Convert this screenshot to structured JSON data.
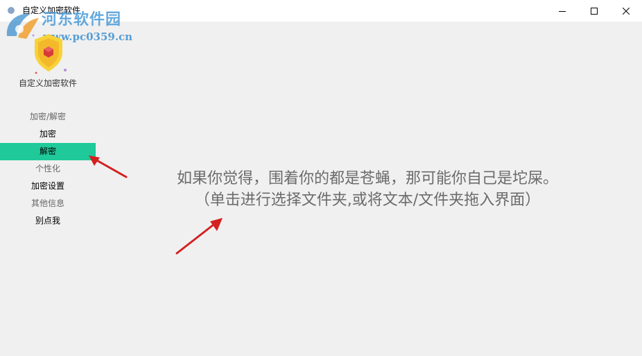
{
  "window": {
    "title": "自定义加密软件"
  },
  "watermark": {
    "site_name": "河东软件园",
    "url": "www.pc0359.cn"
  },
  "sidebar": {
    "app_name": "自定义加密软件",
    "items": [
      {
        "label": "加密/解密",
        "type": "section"
      },
      {
        "label": "加密",
        "type": "item"
      },
      {
        "label": "解密",
        "type": "item",
        "active": true
      },
      {
        "label": "个性化",
        "type": "section"
      },
      {
        "label": "加密设置",
        "type": "item"
      },
      {
        "label": "其他信息",
        "type": "section"
      },
      {
        "label": "别点我",
        "type": "item"
      }
    ]
  },
  "main": {
    "line1": "如果你觉得，围着你的都是苍蝇，那可能你自己是坨屎。",
    "line2": "（单击进行选择文件夹,或将文本/文件夹拖入界面）"
  },
  "colors": {
    "active_item_bg": "#1fc99a",
    "annotation_arrow": "#d42020",
    "content_text": "#6b6b6b"
  }
}
